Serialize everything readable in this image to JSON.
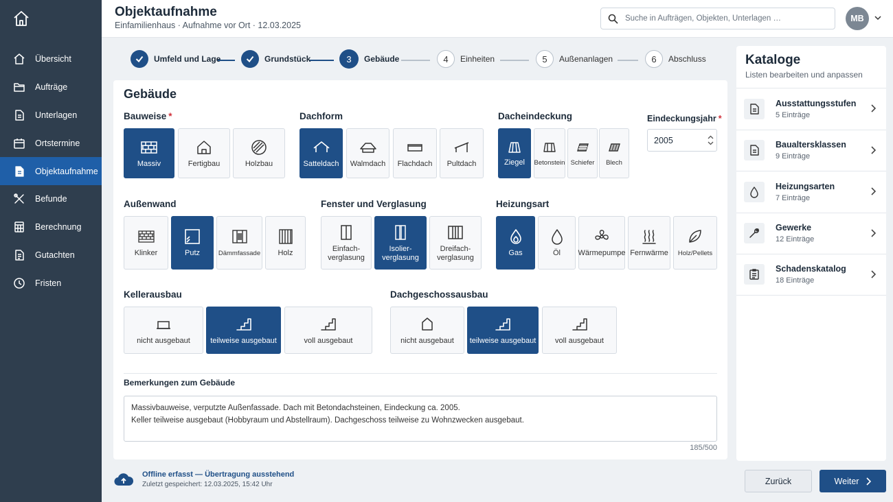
{
  "header": {
    "title": "Objektaufnahme",
    "subtitle": "Einfamilienhaus · Aufnahme vor Ort · 12.03.2025",
    "search_placeholder": "Suche in Aufträgen, Objekten, Unterlagen …",
    "avatar_initials": "MB"
  },
  "sidebar": {
    "items": [
      {
        "label": "Übersicht",
        "icon": "home-icon"
      },
      {
        "label": "Aufträge",
        "icon": "folder-icon"
      },
      {
        "label": "Unterlagen",
        "icon": "document-icon"
      },
      {
        "label": "Ortstermine",
        "icon": "calendar-icon"
      },
      {
        "label": "Objektaufnahme",
        "icon": "document-icon",
        "active": true
      },
      {
        "label": "Befunde",
        "icon": "tools-icon"
      },
      {
        "label": "Berechnung",
        "icon": "calculator-icon"
      },
      {
        "label": "Gutachten",
        "icon": "report-icon"
      },
      {
        "label": "Fristen",
        "icon": "clock-icon"
      }
    ]
  },
  "stepper": {
    "steps": [
      {
        "number": "1",
        "label": "Umfeld und Lage",
        "state": "done"
      },
      {
        "number": "2",
        "label": "Grundstück",
        "state": "done"
      },
      {
        "number": "3",
        "label": "Gebäude",
        "state": "current"
      },
      {
        "number": "4",
        "label": "Einheiten",
        "state": "todo"
      },
      {
        "number": "5",
        "label": "Außenanlagen",
        "state": "todo"
      },
      {
        "number": "6",
        "label": "Abschluss",
        "state": "todo"
      }
    ]
  },
  "form": {
    "title": "Gebäude",
    "bauweise": {
      "label": "Bauweise",
      "options": [
        "Massiv",
        "Fertigbau",
        "Holzbau"
      ],
      "selected": "Massiv"
    },
    "dachform": {
      "label": "Dachform",
      "options": [
        "Satteldach",
        "Walmdach",
        "Flachdach",
        "Pultdach"
      ],
      "selected": "Satteldach"
    },
    "dacheindeckung": {
      "label": "Dacheindeckung",
      "options": [
        "Ziegel",
        "Betonstein",
        "Schiefer",
        "Blech"
      ],
      "selected": "Ziegel"
    },
    "eindeckungsjahr": {
      "label": "Eindeckungsjahr",
      "value": "2005"
    },
    "aussenwand": {
      "label": "Außenwand",
      "options": [
        "Klinker",
        "Putz",
        "Dämmfassade",
        "Holz"
      ],
      "selected": "Putz"
    },
    "fenster": {
      "label": "Fenster und Verglasung",
      "options": [
        "Einfach-\nverglasung",
        "Isolier-\nverglasung",
        "Dreifach-\nverglasung"
      ],
      "selected": "Isolier-\nverglasung"
    },
    "heizungsart": {
      "label": "Heizungsart",
      "options": [
        "Gas",
        "Öl",
        "Wärmepumpe",
        "Fernwärme",
        "Holz/Pellets"
      ],
      "selected": "Gas"
    },
    "kellerausbau": {
      "label": "Kellerausbau",
      "options": [
        "nicht ausgebaut",
        "teilweise ausgebaut",
        "voll ausgebaut"
      ],
      "selected": "teilweise ausgebaut"
    },
    "dachgeschossausbau": {
      "label": "Dachgeschossausbau",
      "options": [
        "nicht ausgebaut",
        "teilweise ausgebaut",
        "voll ausgebaut"
      ],
      "selected": "teilweise ausgebaut"
    },
    "remarks_label": "Bemerkungen zum Gebäude",
    "remarks_value": "Massivbauweise, verputzte Außenfassade. Dach mit Betondachsteinen, Eindeckung ca. 2005.\nKeller teilweise ausgebaut (Hobbyraum und Abstellraum). Dachgeschoss teilweise zu Wohnzwecken ausgebaut.",
    "remarks_counter": "185/500"
  },
  "catalogs": {
    "title": "Kataloge",
    "subtitle": "Listen bearbeiten und anpassen",
    "items": [
      {
        "name": "Ausstattungsstufen",
        "count": "5 Einträge",
        "icon": "document-icon"
      },
      {
        "name": "Baualtersklassen",
        "count": "9 Einträge",
        "icon": "document-icon"
      },
      {
        "name": "Heizungsarten",
        "count": "7 Einträge",
        "icon": "flame-icon"
      },
      {
        "name": "Gewerke",
        "count": "12 Einträge",
        "icon": "wrench-icon"
      },
      {
        "name": "Schadenskatalog",
        "count": "18 Einträge",
        "icon": "checklist-icon"
      }
    ]
  },
  "footer": {
    "status_main": "Offline erfasst — Übertragung ausstehend",
    "status_sub": "Zuletzt gespeichert: 12.03.2025, 15:42 Uhr",
    "back_label": "Zurück",
    "next_label": "Weiter"
  },
  "colors": {
    "sidebar": "#2f3e4e",
    "sidebar_active": "#1f5fa8",
    "primary": "#1f4f87",
    "required": "#d0303a"
  }
}
